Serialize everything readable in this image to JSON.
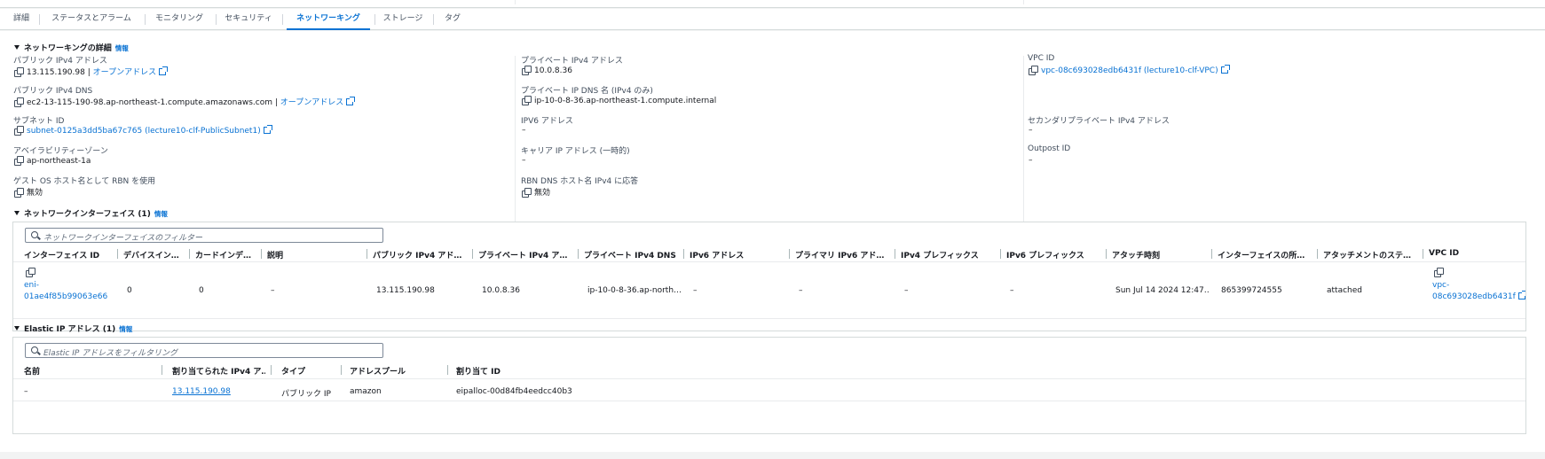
{
  "tabs": [
    "詳細",
    "ステータスとアラーム",
    "モニタリング",
    "セキュリティ",
    "ネットワーキング",
    "ストレージ",
    "タグ"
  ],
  "networking_details": {
    "title": "ネットワーキングの詳細",
    "info": "情報",
    "open_address": "オープンアドレス",
    "fields": {
      "public_ipv4_label": "パブリック IPv4 アドレス",
      "public_ipv4_value": "13.115.190.98 |",
      "private_ipv4_label": "プライベート IPv4 アドレス",
      "private_ipv4_value": "10.0.8.36",
      "vpc_id_label": "VPC ID",
      "vpc_id_value": "vpc-08c693028edb6431f (lecture10-clf-VPC)",
      "public_dns_label": "パブリック IPv4 DNS",
      "public_dns_value": "ec2-13-115-190-98.ap-northeast-1.compute.amazonaws.com |",
      "private_dns_label": "プライベート IP DNS 名 (IPv4 のみ)",
      "private_dns_value": "ip-10-0-8-36.ap-northeast-1.compute.internal",
      "subnet_label": "サブネット ID",
      "subnet_value": "subnet-0125a3dd5ba67c765 (lecture10-clf-PublicSubnet1)",
      "ipv6_label": "IPV6 アドレス",
      "ipv6_value": "–",
      "secondary_label": "セカンダリプライベート IPv4 アドレス",
      "secondary_value": "–",
      "az_label": "アベイラビリティーゾーン",
      "az_value": "ap-northeast-1a",
      "carrier_label": "キャリア IP アドレス (一時的)",
      "carrier_value": "–",
      "outpost_label": "Outpost ID",
      "outpost_value": "–",
      "rbn_label": "ゲスト OS ホスト名として RBN を使用",
      "rbn_value": "無効",
      "rbn_dns_label": "RBN DNS ホスト名 IPv4 に応答",
      "rbn_dns_value": "無効"
    }
  },
  "network_interfaces": {
    "title": "ネットワークインターフェイス (1)",
    "info": "情報",
    "filter_placeholder": "ネットワークインターフェイスのフィルター",
    "columns": [
      "インターフェイス ID",
      "デバイスイン…",
      "カードインデ…",
      "説明",
      "パブリック IPv4 アド…",
      "プライベート IPv4 ア…",
      "プライベート IPv4 DNS",
      "IPv6 アドレス",
      "プライマリ IPv6 アド…",
      "IPv4 プレフィックス",
      "IPv6 プレフィックス",
      "アタッチ時刻",
      "インターフェイスの所…",
      "アタッチメントのステ…",
      "VPC ID"
    ],
    "row": {
      "interface_id_1": "eni-",
      "interface_id_2": "01ae4f85b99063e66",
      "device_index": "0",
      "card_index": "0",
      "description": "–",
      "public_ipv4": "13.115.190.98",
      "private_ipv4": "10.0.8.36",
      "private_dns": "ip-10-0-8-36.ap-north…",
      "ipv6": "–",
      "primary_ipv6": "–",
      "ipv4_prefix": "–",
      "ipv6_prefix": "–",
      "attach_time": "Sun Jul 14 2024 12:47…",
      "owner": "865399724555",
      "attachment_status": "attached",
      "vpc_id_1": "vpc-",
      "vpc_id_2": "08c693028edb6431f"
    }
  },
  "elastic_ip": {
    "title": "Elastic IP アドレス (1)",
    "info": "情報",
    "filter_placeholder": "Elastic IP アドレスをフィルタリング",
    "columns": [
      "名前",
      "割り当てられた IPv4 ア…",
      "タイプ",
      "アドレスプール",
      "割り当て ID"
    ],
    "row": {
      "name": "–",
      "ipv4": "13.115.190.98",
      "type": "パブリック IP",
      "pool": "amazon",
      "allocation_id": "eipalloc-00d84fb4eedcc40b3"
    }
  },
  "colors": {
    "link": "#0972d3",
    "text": "#16191f",
    "label": "#414d5c",
    "border": "#d5dbdb"
  }
}
